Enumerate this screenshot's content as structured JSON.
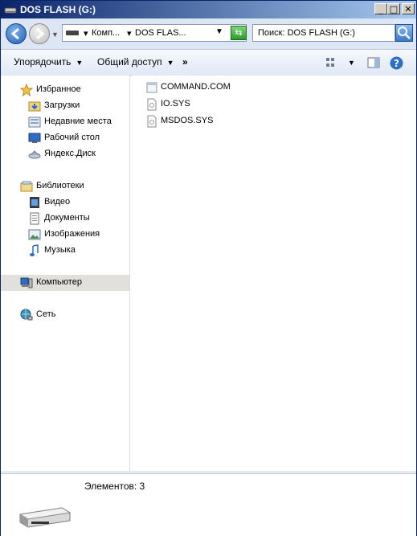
{
  "window": {
    "title": "DOS FLASH (G:)",
    "controls": {
      "minimize": "_",
      "maximize": "□",
      "close": "✕"
    }
  },
  "address": {
    "crumbs": [
      "Комп...",
      "DOS FLAS..."
    ],
    "search_placeholder": "Поиск: DOS FLASH (G:)"
  },
  "toolbar": {
    "organize": "Упорядочить",
    "share": "Общий доступ",
    "more": "»"
  },
  "nav": {
    "favorites": {
      "label": "Избранное",
      "items": [
        "Загрузки",
        "Недавние места",
        "Рабочий стол",
        "Яндекс.Диск"
      ]
    },
    "libraries": {
      "label": "Библиотеки",
      "items": [
        "Видео",
        "Документы",
        "Изображения",
        "Музыка"
      ]
    },
    "computer": "Компьютер",
    "network": "Сеть"
  },
  "files": [
    {
      "name": "COMMAND.COM",
      "icon": "application-icon"
    },
    {
      "name": "IO.SYS",
      "icon": "system-file-icon"
    },
    {
      "name": "MSDOS.SYS",
      "icon": "system-file-icon"
    }
  ],
  "details": {
    "count_text": "Элементов: 3"
  },
  "colors": {
    "titlebar_start": "#0a246a",
    "titlebar_end": "#a6caf0",
    "selection": "#e2e0dc"
  }
}
